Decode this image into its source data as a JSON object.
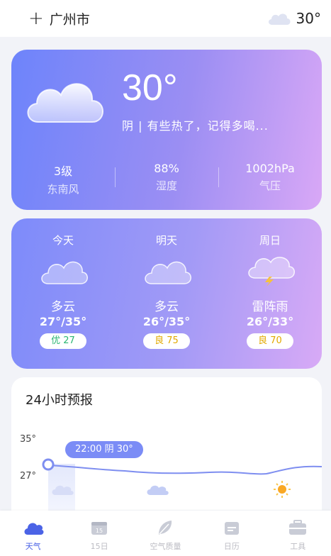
{
  "header": {
    "add_icon": "plus-icon",
    "city": "广州市",
    "weather_icon": "cloud-icon",
    "temp": "30°"
  },
  "current": {
    "temp": "30°",
    "description": "阴 | 有些热了，记得多喝...",
    "icon": "cloud-icon",
    "stats": [
      {
        "value": "3级",
        "label": "东南风"
      },
      {
        "value": "88%",
        "label": "湿度"
      },
      {
        "value": "1002hPa",
        "label": "气压"
      }
    ]
  },
  "forecast": [
    {
      "day": "今天",
      "icon": "cloud-icon",
      "condition": "多云",
      "range": "27°/35°",
      "aqi": "优 27",
      "aqi_level": "good"
    },
    {
      "day": "明天",
      "icon": "cloud-icon",
      "condition": "多云",
      "range": "26°/35°",
      "aqi": "良 75",
      "aqi_level": "fair"
    },
    {
      "day": "周日",
      "icon": "thunderstorm-icon",
      "condition": "雷阵雨",
      "range": "26°/33°",
      "aqi": "良 70",
      "aqi_level": "fair"
    }
  ],
  "hourly": {
    "title": "24小时预报",
    "y_labels": [
      "35°",
      "27°"
    ],
    "tooltip": "22:00 阴 30°",
    "icons": [
      "cloud-icon",
      "cloud-icon",
      "sun-icon"
    ]
  },
  "nav": {
    "items": [
      {
        "label": "天气",
        "icon": "weather-icon",
        "active": true
      },
      {
        "label": "15日",
        "icon": "calendar-15-icon",
        "active": false
      },
      {
        "label": "空气质量",
        "icon": "leaf-icon",
        "active": false
      },
      {
        "label": "日历",
        "icon": "calendar-icon",
        "active": false
      },
      {
        "label": "工具",
        "icon": "toolbox-icon",
        "active": false
      }
    ]
  },
  "colors": {
    "accent": "#4b63e6",
    "card_gradient_start": "#6d84fb",
    "card_gradient_end": "#d9a8f6",
    "aqi_good": "#2bb673",
    "aqi_fair": "#e2a900"
  }
}
